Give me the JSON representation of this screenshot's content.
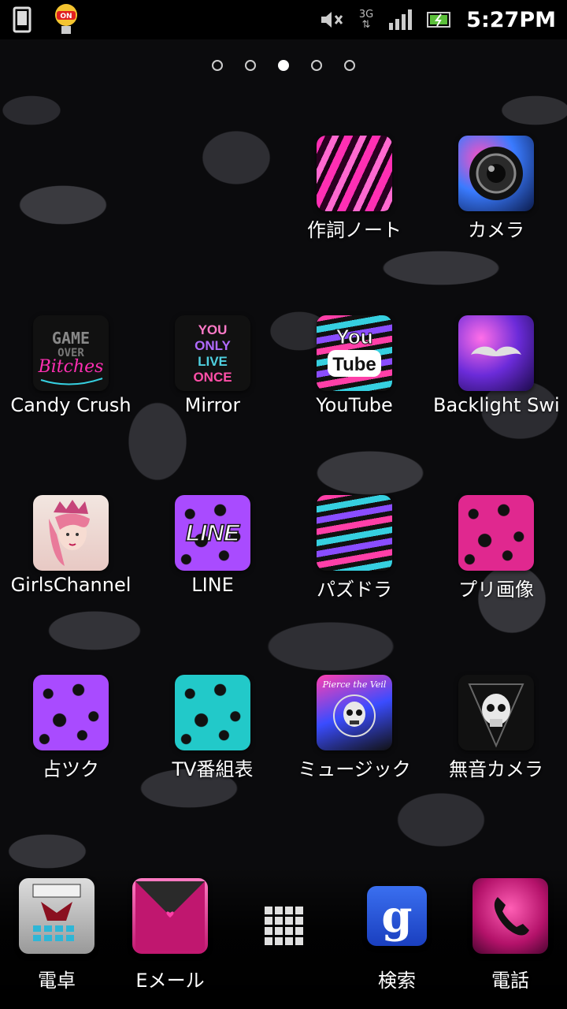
{
  "status_bar": {
    "time": "5:27PM",
    "network": "3G",
    "icons": [
      "phone-icon",
      "on-badge-icon",
      "mute-icon",
      "3g-icon",
      "signal-icon",
      "battery-icon"
    ]
  },
  "pages": {
    "count": 5,
    "active": 3
  },
  "apps": [
    {
      "label": "作詞ノート",
      "icon": "zebra-pink-icon"
    },
    {
      "label": "カメラ",
      "icon": "camera-icon"
    },
    {
      "label": "Candy Crush",
      "icon": "game-over-icon",
      "icon_text": [
        "GAME",
        "OVER",
        "Bitches"
      ]
    },
    {
      "label": "Mirror",
      "icon": "yolo-icon",
      "icon_text": [
        "YOU",
        "ONLY",
        "LIVE",
        "ONCE"
      ]
    },
    {
      "label": "YouTube",
      "icon": "youtube-icon",
      "icon_text": [
        "You",
        "Tube"
      ]
    },
    {
      "label": "Backlight Swit",
      "icon": "mustache-icon"
    },
    {
      "label": "GirlsChannel",
      "icon": "girl-crown-icon"
    },
    {
      "label": "LINE",
      "icon": "line-icon",
      "icon_text": [
        "LINE"
      ]
    },
    {
      "label": "パズドラ",
      "icon": "zebra-multi-icon"
    },
    {
      "label": "プリ画像",
      "icon": "leopard-glitter-icon"
    },
    {
      "label": "占ツク",
      "icon": "leopard-purple-icon"
    },
    {
      "label": "TV番組表",
      "icon": "leopard-teal-icon"
    },
    {
      "label": "ミュージック",
      "icon": "pierce-the-veil-icon",
      "icon_text": [
        "Pierce the Veil"
      ]
    },
    {
      "label": "無音カメラ",
      "icon": "skull-icon"
    }
  ],
  "dock": [
    {
      "label": "電卓",
      "icon": "calculator-icon"
    },
    {
      "label": "Eメール",
      "icon": "email-icon"
    },
    {
      "label": "",
      "icon": "app-drawer-icon"
    },
    {
      "label": "検索",
      "icon": "google-search-icon",
      "icon_text": "g"
    },
    {
      "label": "電話",
      "icon": "phone-call-icon"
    }
  ],
  "colors": {
    "accent": "#ff2fb3",
    "status_bar_bg": "#000000",
    "text": "#ffffff"
  }
}
